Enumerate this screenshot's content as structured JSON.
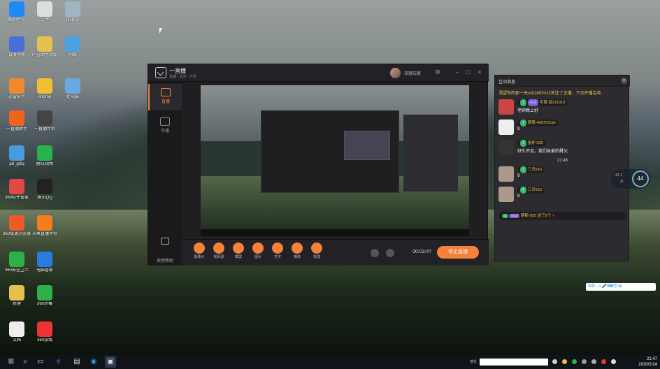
{
  "desktop": {
    "icons": [
      {
        "label": "酷狗音乐",
        "color": "#1e8af7"
      },
      {
        "label": "文件",
        "color": "#ddd"
      },
      {
        "label": "回收站",
        "color": "#9fb5c4"
      },
      {
        "label": "百度网盘",
        "color": "#4a6fd6"
      },
      {
        "label": "问答助手题库",
        "color": "#e6c04f"
      },
      {
        "label": "网络",
        "color": "#4aa2e0"
      },
      {
        "label": "迅雷影音",
        "color": "#f08a2a"
      },
      {
        "label": "ehome",
        "color": "#f0c030"
      },
      {
        "label": "此电脑",
        "color": "#6aa8e0"
      },
      {
        "label": "一直播助手",
        "color": "#f0631a"
      },
      {
        "label": "一直播伴侣",
        "color": "#444"
      },
      {
        "label": "pd_gfzq",
        "color": "#4a9ae0"
      },
      {
        "label": "腾讯视频",
        "color": "#2bb34b"
      },
      {
        "label": "360软件管家",
        "color": "#e34848"
      },
      {
        "label": "腾讯QQ",
        "color": "#222"
      },
      {
        "label": "360极速浏览器",
        "color": "#f05a2a"
      },
      {
        "label": "斗鱼直播伴侣",
        "color": "#f57e1c"
      },
      {
        "label": "360安全卫士",
        "color": "#2db04a"
      },
      {
        "label": "电脑管家",
        "color": "#2a7ae0"
      },
      {
        "label": "新建",
        "color": "#e6c04f"
      },
      {
        "label": "360杀毒",
        "color": "#2db04a"
      },
      {
        "label": "文档",
        "color": "#eee"
      },
      {
        "label": "360游戏",
        "color": "#e33"
      }
    ]
  },
  "app": {
    "name": "一直播",
    "subtitle": "直播 · 生活 · 分享",
    "username": "深度玩家",
    "sidebar": [
      {
        "label": "直播"
      },
      {
        "label": "导播"
      }
    ],
    "help_label": "使用帮助",
    "tools": [
      "摄像头",
      "视频源",
      "截屏",
      "图片",
      "文字",
      "捕获",
      "管理"
    ],
    "timer": "00:03:47",
    "stop_label": "停止直播"
  },
  "chat": {
    "title": "互动消息",
    "notice": "渴望你的那一天cs024f0rv22关注了主播，下次开播会收",
    "messages": [
      {
        "level": "1",
        "badge": "Lv.2",
        "nick": "芊恩 就221913",
        "text": "老师晚上好",
        "avatar": "#c44"
      },
      {
        "level": "1",
        "badge": "",
        "nick": "萌萌-409757zsb",
        "text": "9",
        "avatar": "#eee"
      },
      {
        "level": "1",
        "badge": "",
        "nick": "张炸 936",
        "text": "好久不见，我们亲爱的舜父",
        "avatar": "#333"
      }
    ],
    "time": "21:46",
    "messages2": [
      {
        "level": "1",
        "badge": "",
        "nick": "三贝916",
        "text": "9",
        "avatar": "#a98"
      },
      {
        "level": "1",
        "badge": "",
        "nick": "三贝916",
        "text": "9",
        "avatar": "#a98"
      }
    ],
    "gift": {
      "level": "1",
      "badge": "Lv.2",
      "text": "萌新-925 送了5个"
    }
  },
  "widget": {
    "speed_up": "↑97.1",
    "speed_down": "↓0",
    "percent": "44"
  },
  "ime": "S中·,☺🎤⌨👕⊞",
  "taskbar": {
    "search_label": "地址",
    "time": "21:47",
    "date": "2020/2/24"
  }
}
